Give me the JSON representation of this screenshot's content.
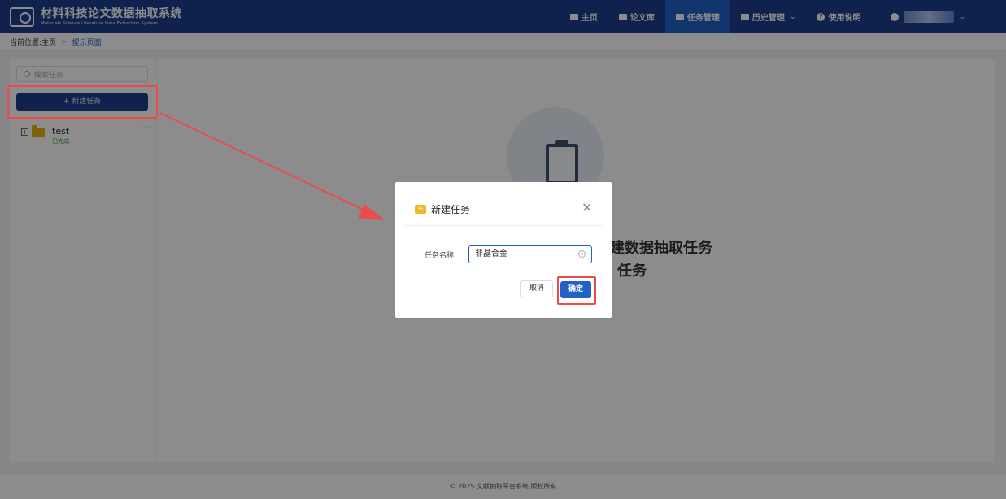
{
  "header": {
    "title": "材料科技论文数据抽取系统",
    "subtitle": "Materials Science Literature Data Extraction System",
    "nav": [
      {
        "label": "主页",
        "icon": "home-icon"
      },
      {
        "label": "论文库",
        "icon": "book-icon"
      },
      {
        "label": "任务管理",
        "icon": "task-icon"
      },
      {
        "label": "历史管理",
        "icon": "history-icon"
      },
      {
        "label": "使用说明",
        "icon": "help-icon"
      }
    ],
    "active_nav": "任务管理"
  },
  "breadcrumb": {
    "prefix": "当前位置:",
    "home": "主页",
    "current": "提示页面"
  },
  "sidebar": {
    "search_placeholder": "搜索任务",
    "new_task_label": "+ 新建任务",
    "tasks": [
      {
        "name": "test",
        "status": "已完成"
      }
    ]
  },
  "main": {
    "text_line1": "建数据抽取任务",
    "text_line2": "任务"
  },
  "dialog": {
    "title": "新建任务",
    "field_label": "任务名称:",
    "field_value": "非晶合金",
    "cancel_label": "取消",
    "ok_label": "确定"
  },
  "footer": {
    "text": "© 2025 文献抽取平台系统 版权所有"
  },
  "colors": {
    "header_bg": "#1a3e8c",
    "accent": "#2262c6",
    "highlight": "#ee4a4a",
    "status_green": "#2ea62e"
  }
}
